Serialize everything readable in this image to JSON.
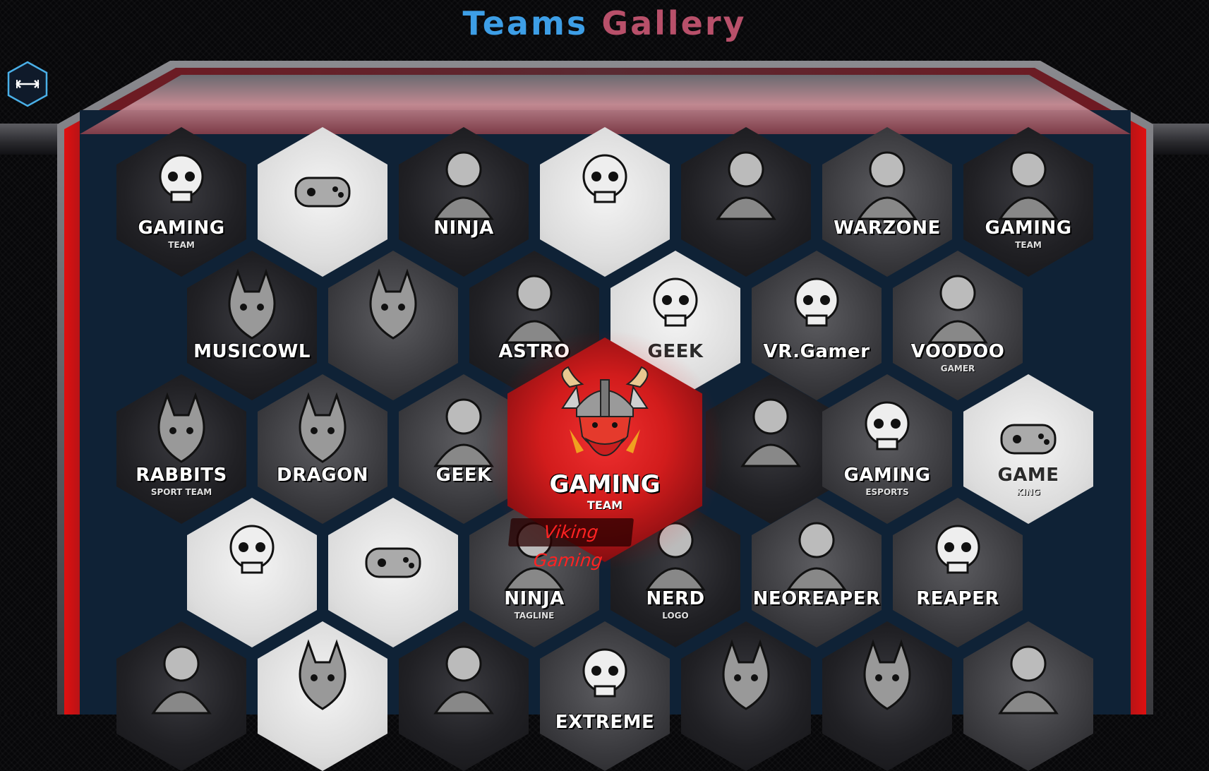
{
  "page": {
    "title_part1": "Teams",
    "title_part2": "Gallery"
  },
  "toolbar": {
    "toggle_icon": "expand-horizontal-icon"
  },
  "featured": {
    "logo_text": "GAMING",
    "logo_subtext": "TEAM",
    "caption": "Viking Gaming"
  },
  "rows": [
    [
      {
        "name": "gaming-skull",
        "text": "GAMING",
        "sub": "TEAM",
        "style": "dark",
        "icon": "skull-icon"
      },
      {
        "name": "controller-hand",
        "text": "",
        "sub": "",
        "style": "light",
        "icon": "controller-hand-icon"
      },
      {
        "name": "ninja",
        "text": "NINJA",
        "sub": "",
        "style": "dark",
        "icon": "ninja-icon"
      },
      {
        "name": "skull-headset",
        "text": "",
        "sub": "",
        "style": "light",
        "icon": "skull-headset-icon"
      },
      {
        "name": "hooded-figure",
        "text": "",
        "sub": "",
        "style": "dark",
        "icon": "hood-icon"
      },
      {
        "name": "warzone",
        "text": "WARZONE",
        "sub": "",
        "style": "mid",
        "icon": "soldier-icon"
      },
      {
        "name": "gaming-ninja",
        "text": "GAMING",
        "sub": "TEAM",
        "style": "dark",
        "icon": "ninja-flame-icon"
      }
    ],
    [
      {
        "name": "musicowl",
        "text": "MUSICOWL",
        "sub": "",
        "style": "dark",
        "icon": "owl-icon"
      },
      {
        "name": "eagle",
        "text": "",
        "sub": "",
        "style": "mid",
        "icon": "eagle-icon"
      },
      {
        "name": "astro",
        "text": "ASTRO",
        "sub": "",
        "style": "dark",
        "icon": "astronaut-icon"
      },
      {
        "name": "geek-skull",
        "text": "GEEK",
        "sub": "",
        "style": "light",
        "icon": "geek-skull-icon"
      },
      {
        "name": "vr-gamer",
        "text": "VR.Gamer",
        "sub": "",
        "style": "mid",
        "icon": "vr-skull-icon"
      },
      {
        "name": "voodoo-gamer",
        "text": "VOODOO",
        "sub": "GAMER",
        "style": "mid",
        "icon": "voodoo-doll-icon"
      }
    ],
    [
      {
        "name": "rabbits",
        "text": "RABBITS",
        "sub": "SPORT TEAM",
        "style": "dark",
        "icon": "rabbit-icon"
      },
      {
        "name": "dragon",
        "text": "DRAGON",
        "sub": "",
        "style": "mid",
        "icon": "dragon-icon"
      },
      {
        "name": "geek-boy",
        "text": "GEEK",
        "sub": "",
        "style": "mid",
        "icon": "geek-boy-icon"
      },
      {
        "name": "samurai",
        "text": "",
        "sub": "",
        "style": "dark",
        "icon": "samurai-icon"
      },
      {
        "name": "gaming-esports",
        "text": "GAMING",
        "sub": "ESPORTS",
        "style": "mid",
        "icon": "skull-headphones-icon"
      },
      {
        "name": "game-king",
        "text": "GAME",
        "sub": "KING",
        "style": "light",
        "icon": "rock-hand-icon"
      }
    ],
    [
      {
        "name": "jester",
        "text": "",
        "sub": "",
        "style": "light",
        "icon": "jester-skull-icon"
      },
      {
        "name": "astronaut-controller",
        "text": "",
        "sub": "",
        "style": "light",
        "icon": "astronaut-controller-icon"
      },
      {
        "name": "ninja-tagline",
        "text": "NINJA",
        "sub": "TAGLINE",
        "style": "mid",
        "icon": "ninja-mask-icon"
      },
      {
        "name": "nerd",
        "text": "NERD",
        "sub": "LOGO",
        "style": "dark",
        "icon": "nerd-icon"
      },
      {
        "name": "neoreaper",
        "text": "NEOREAPER",
        "sub": "",
        "style": "mid",
        "icon": "reaper-gun-icon"
      },
      {
        "name": "reaper",
        "text": "REAPER",
        "sub": "",
        "style": "mid",
        "icon": "reaper-skull-icon"
      }
    ],
    [
      {
        "name": "assassin",
        "text": "",
        "sub": "",
        "style": "dark",
        "icon": "assassin-icon"
      },
      {
        "name": "dino",
        "text": "",
        "sub": "",
        "style": "light",
        "icon": "dino-icon"
      },
      {
        "name": "robot-wolf",
        "text": "",
        "sub": "",
        "style": "dark",
        "icon": "robot-icon"
      },
      {
        "name": "extreme-fire",
        "text": "EXTREME",
        "sub": "",
        "style": "mid",
        "icon": "flame-skull-icon"
      },
      {
        "name": "dragon-horn",
        "text": "",
        "sub": "",
        "style": "dark",
        "icon": "horned-dragon-icon"
      },
      {
        "name": "gorilla",
        "text": "",
        "sub": "",
        "style": "dark",
        "icon": "gorilla-icon"
      },
      {
        "name": "ninja-star",
        "text": "",
        "sub": "",
        "style": "mid",
        "icon": "ninja-star-icon"
      }
    ]
  ]
}
